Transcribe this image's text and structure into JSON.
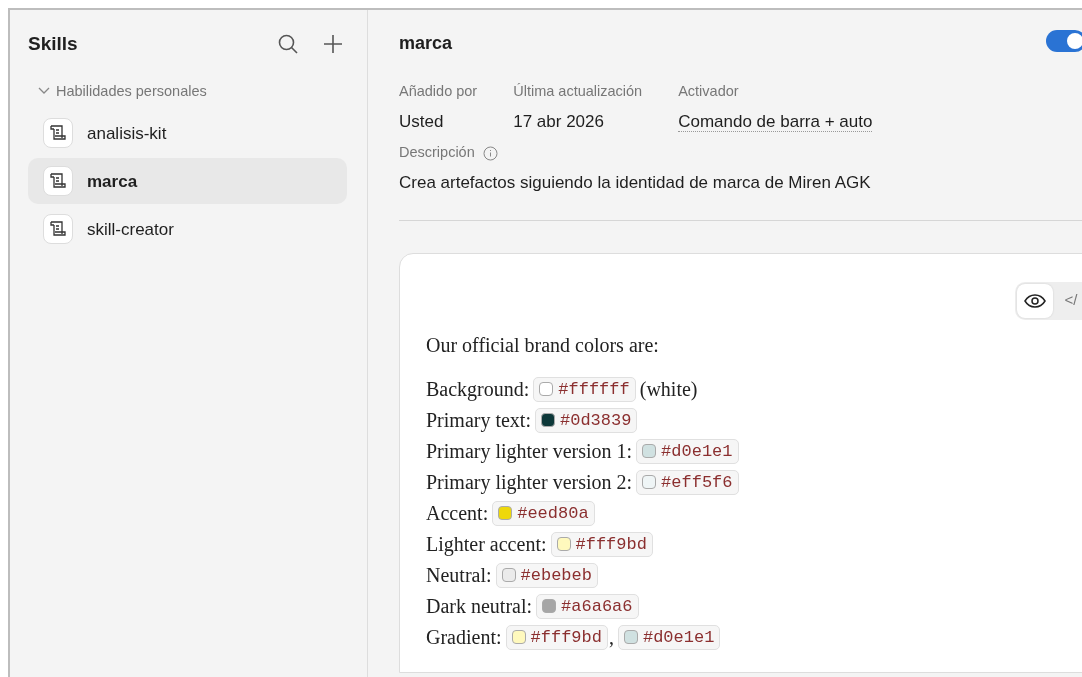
{
  "sidebar": {
    "title": "Skills",
    "group": {
      "label": "Habilidades personales",
      "expanded": true,
      "items": [
        {
          "label": "analisis-kit",
          "selected": false
        },
        {
          "label": "marca",
          "selected": true
        },
        {
          "label": "skill-creator",
          "selected": false
        }
      ]
    }
  },
  "detail": {
    "title": "marca",
    "enabled": true,
    "meta": [
      {
        "label": "Añadido por",
        "value": "Usted",
        "kind": "plain"
      },
      {
        "label": "Última actualización",
        "value": "17 abr 2026",
        "kind": "plain"
      },
      {
        "label": "Activador",
        "value": "Comando de barra + auto",
        "kind": "dotted"
      }
    ],
    "description_label": "Descripción",
    "description": "Crea artefactos siguiendo la identidad de marca de Miren AGK"
  },
  "preview": {
    "view_toggle": [
      {
        "kind": "preview",
        "selected": true
      },
      {
        "kind": "code",
        "label": "</",
        "selected": false
      }
    ],
    "intro": "Our official brand colors are:",
    "colors": [
      {
        "label": "Background:",
        "chips": [
          {
            "code": "#ffffff",
            "color": "#ffffff"
          }
        ],
        "suffix": "(white)"
      },
      {
        "label": "Primary text:",
        "chips": [
          {
            "code": "#0d3839",
            "color": "#0d3839"
          }
        ]
      },
      {
        "label": "Primary lighter version 1:",
        "chips": [
          {
            "code": "#d0e1e1",
            "color": "#d0e1e1"
          }
        ]
      },
      {
        "label": "Primary lighter version 2:",
        "chips": [
          {
            "code": "#eff5f6",
            "color": "#eff5f6"
          }
        ]
      },
      {
        "label": "Accent:",
        "chips": [
          {
            "code": "#eed80a",
            "color": "#eed80a"
          }
        ]
      },
      {
        "label": "Lighter accent:",
        "chips": [
          {
            "code": "#fff9bd",
            "color": "#fff9bd"
          }
        ]
      },
      {
        "label": "Neutral:",
        "chips": [
          {
            "code": "#ebebeb",
            "color": "#ebebeb"
          }
        ]
      },
      {
        "label": "Dark neutral:",
        "chips": [
          {
            "code": "#a6a6a6",
            "color": "#a6a6a6"
          }
        ]
      },
      {
        "label": "Gradient:",
        "chips": [
          {
            "code": "#fff9bd",
            "color": "#fff9bd"
          },
          {
            "code": "#d0e1e1",
            "color": "#d0e1e1"
          }
        ],
        "separator": ","
      }
    ]
  }
}
